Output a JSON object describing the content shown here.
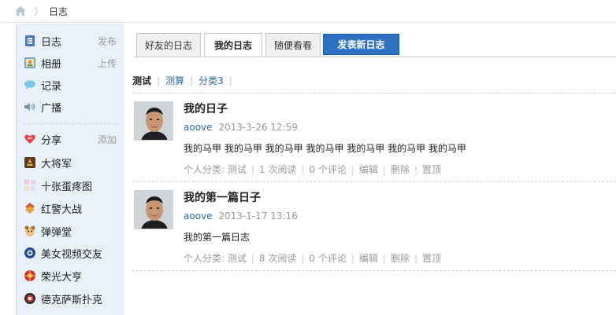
{
  "breadcrumb": {
    "home_icon": "home-icon",
    "separator": "〉",
    "current": "日志"
  },
  "sidebar": {
    "items": [
      {
        "label": "日志",
        "action": "发布",
        "icon": "blog-icon"
      },
      {
        "label": "相册",
        "action": "上传",
        "icon": "photo-album-icon"
      },
      {
        "label": "记录",
        "action": "",
        "icon": "speech-bubble-icon"
      },
      {
        "label": "广播",
        "action": "",
        "icon": "speaker-icon"
      }
    ],
    "apps": [
      {
        "label": "分享",
        "action": "添加",
        "icon": "share-heart-icon"
      },
      {
        "label": "大将军",
        "icon": "general-game-icon"
      },
      {
        "label": "十张蛋疼图",
        "icon": "image-grid-icon"
      },
      {
        "label": "红警大战",
        "icon": "red-alert-icon"
      },
      {
        "label": "弹弹堂",
        "icon": "ddtank-icon"
      },
      {
        "label": "美女视频交友",
        "icon": "video-chat-icon"
      },
      {
        "label": "荣光大亨",
        "icon": "tycoon-icon"
      },
      {
        "label": "德克萨斯扑克",
        "icon": "poker-icon"
      }
    ]
  },
  "tabs": [
    {
      "label": "好友的日志",
      "active": false
    },
    {
      "label": "我的日志",
      "active": true
    },
    {
      "label": "随便看看",
      "active": false
    }
  ],
  "post_button": "发表新日志",
  "categories": [
    {
      "label": "测试",
      "current": true
    },
    {
      "label": "测算",
      "current": false
    },
    {
      "label": "分类3",
      "current": false
    }
  ],
  "separator": "|",
  "entries": [
    {
      "title": "我的日子",
      "author": "aoove",
      "time": "2013-3-26 12:59",
      "body": "我的马甲 我的马甲 我的马甲 我的马甲 我的马甲 我的马甲 我的马甲",
      "category": "个人分类: 测试",
      "reads": "1 次阅读",
      "comments": "0 个评论",
      "edit": "编辑",
      "delete": "删除",
      "pin": "置顶"
    },
    {
      "title": "我的第一篇日子",
      "author": "aoove",
      "time": "2013-1-17 13:16",
      "body": "我的第一篇日志",
      "category": "个人分类: 测试",
      "reads": "8 次阅读",
      "comments": "0 个评论",
      "edit": "编辑",
      "delete": "删除",
      "pin": "置顶"
    }
  ],
  "colors": {
    "link": "#2b6aa8",
    "post_button": "#2f72c5",
    "sidebar_bg": "#e8f1fa"
  }
}
